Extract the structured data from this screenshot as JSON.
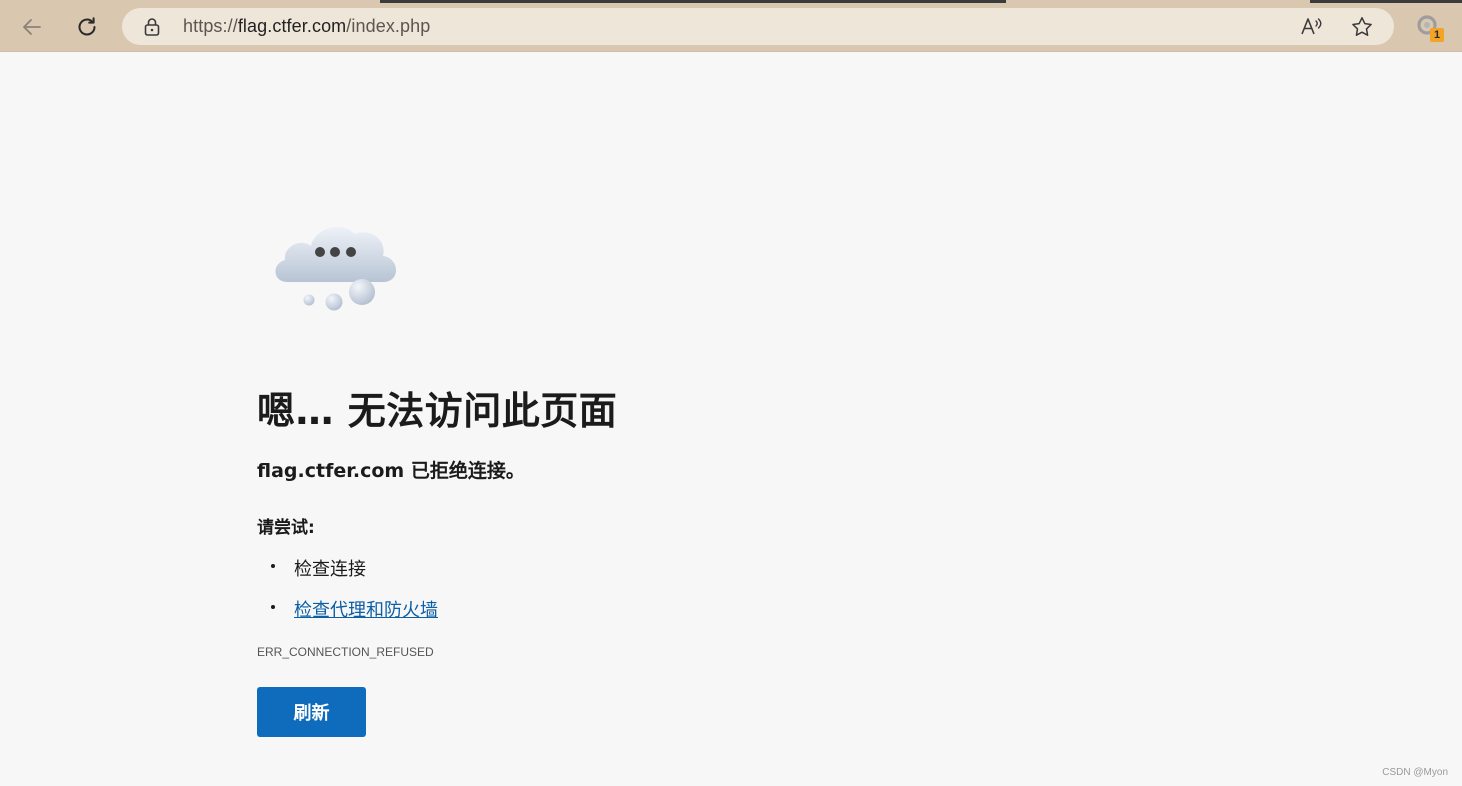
{
  "browser": {
    "url": {
      "scheme": "https://",
      "host": "flag.ctfer.com",
      "path": "/index.php"
    },
    "extension_badge": "1",
    "icons": {
      "back": "back-arrow-icon",
      "reload": "reload-icon",
      "lock": "lock-icon",
      "read_aloud": "read-aloud-icon",
      "favorite": "star-icon",
      "extension": "extension-icon"
    }
  },
  "error_page": {
    "title": "嗯… 无法访问此页面",
    "subtitle": "flag.ctfer.com 已拒绝连接。",
    "try_label": "请尝试:",
    "suggestions": [
      {
        "text": "检查连接",
        "is_link": false
      },
      {
        "text": "检查代理和防火墙",
        "is_link": true
      }
    ],
    "error_code": "ERR_CONNECTION_REFUSED",
    "refresh_label": "刷新",
    "illustration": "cloud-thinking-icon"
  },
  "watermark": "CSDN @Myon⁠",
  "colors": {
    "chrome_bg": "#d9c7b0",
    "omnibox_bg": "#efe6da",
    "page_bg": "#f7f7f7",
    "accent": "#0f6cbd",
    "link": "#0b5fa5",
    "badge": "#f4a425"
  }
}
